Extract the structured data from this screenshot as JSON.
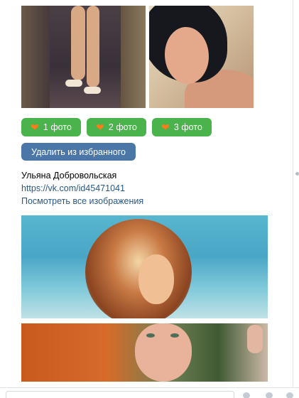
{
  "counts_buttons": [
    {
      "heart_icon": "heart-icon",
      "label": "1 фото"
    },
    {
      "heart_icon": "heart-icon",
      "label": "2 фото"
    },
    {
      "heart_icon": "heart-icon",
      "label": "3 фото"
    }
  ],
  "remove_button_label": "Удалить из избранного",
  "user": {
    "name": "Ульяна Добровольская",
    "link": "https://vk.com/id45471041",
    "view_all_label": "Посмотреть все изображения"
  },
  "colors": {
    "chip_green": "#4bb34b",
    "button_blue": "#4a76a8",
    "link_blue": "#2a5885",
    "heart_orange": "#ff7a1a"
  }
}
